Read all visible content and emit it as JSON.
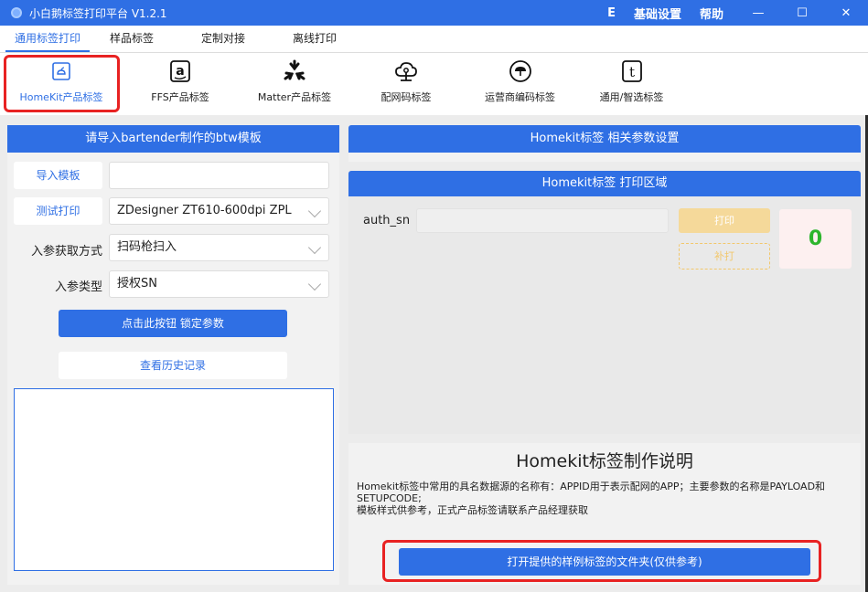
{
  "app": {
    "title": "小白鹅标签打印平台 V1.2.1"
  },
  "titlebar": {
    "menu_e": "E",
    "menu_settings": "基础设置",
    "menu_help": "帮助",
    "min": "—",
    "max": "☐",
    "close": "✕"
  },
  "tabs": [
    {
      "label": "通用标签打印",
      "active": true
    },
    {
      "label": "样品标签"
    },
    {
      "label": "定制对接"
    },
    {
      "label": "离线打印"
    }
  ],
  "subtabs": [
    {
      "label": "HomeKit产品标签",
      "icon": "homekit-icon",
      "active": true
    },
    {
      "label": "FFS产品标签",
      "icon": "amazon-icon"
    },
    {
      "label": "Matter产品标签",
      "icon": "matter-icon"
    },
    {
      "label": "配网码标签",
      "icon": "cloud-network-icon"
    },
    {
      "label": "运营商编码标签",
      "icon": "umbrella-icon"
    },
    {
      "label": "通用/智选标签",
      "icon": "t-letter-icon"
    }
  ],
  "left": {
    "header": "请导入bartender制作的btw模板",
    "import_btn": "导入模板",
    "import_value": "",
    "test_print_btn": "测试打印",
    "printer_value": "ZDesigner ZT610-600dpi ZPL",
    "param_mode_label": "入参获取方式",
    "param_mode_value": "扫码枪扫入",
    "param_type_label": "入参类型",
    "param_type_value": "授权SN",
    "lock_btn": "点击此按钮 锁定参数",
    "history_btn": "查看历史记录"
  },
  "right": {
    "params_header": "Homekit标签 相关参数设置",
    "print_header": "Homekit标签 打印区域",
    "auth_label": "auth_sn",
    "auth_value": "",
    "print_btn": "打印",
    "reprint_btn": "补打",
    "count": "0",
    "desc_title": "Homekit标签制作说明",
    "desc_line1": "Homekit标签中常用的具名数据源的名称有：APPID用于表示配网的APP；主要参数的名称是PAYLOAD和SETUPCODE;",
    "desc_line2": "模板样式供参考，正式产品标签请联系产品经理获取",
    "open_folder_btn": "打开提供的样例标签的文件夹(仅供参考)"
  },
  "colors": {
    "primary": "#2f6fe4",
    "highlight": "#e82222",
    "count_green": "#2db52d"
  }
}
